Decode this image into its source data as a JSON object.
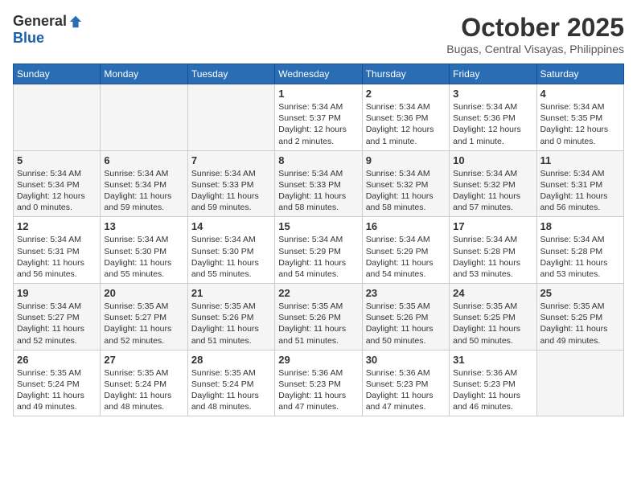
{
  "header": {
    "logo_general": "General",
    "logo_blue": "Blue",
    "month_year": "October 2025",
    "location": "Bugas, Central Visayas, Philippines"
  },
  "weekdays": [
    "Sunday",
    "Monday",
    "Tuesday",
    "Wednesday",
    "Thursday",
    "Friday",
    "Saturday"
  ],
  "weeks": [
    [
      {
        "day": "",
        "empty": true
      },
      {
        "day": "",
        "empty": true
      },
      {
        "day": "",
        "empty": true
      },
      {
        "day": "1",
        "sunrise": "Sunrise: 5:34 AM",
        "sunset": "Sunset: 5:37 PM",
        "daylight": "Daylight: 12 hours and 2 minutes."
      },
      {
        "day": "2",
        "sunrise": "Sunrise: 5:34 AM",
        "sunset": "Sunset: 5:36 PM",
        "daylight": "Daylight: 12 hours and 1 minute."
      },
      {
        "day": "3",
        "sunrise": "Sunrise: 5:34 AM",
        "sunset": "Sunset: 5:36 PM",
        "daylight": "Daylight: 12 hours and 1 minute."
      },
      {
        "day": "4",
        "sunrise": "Sunrise: 5:34 AM",
        "sunset": "Sunset: 5:35 PM",
        "daylight": "Daylight: 12 hours and 0 minutes."
      }
    ],
    [
      {
        "day": "5",
        "sunrise": "Sunrise: 5:34 AM",
        "sunset": "Sunset: 5:34 PM",
        "daylight": "Daylight: 12 hours and 0 minutes."
      },
      {
        "day": "6",
        "sunrise": "Sunrise: 5:34 AM",
        "sunset": "Sunset: 5:34 PM",
        "daylight": "Daylight: 11 hours and 59 minutes."
      },
      {
        "day": "7",
        "sunrise": "Sunrise: 5:34 AM",
        "sunset": "Sunset: 5:33 PM",
        "daylight": "Daylight: 11 hours and 59 minutes."
      },
      {
        "day": "8",
        "sunrise": "Sunrise: 5:34 AM",
        "sunset": "Sunset: 5:33 PM",
        "daylight": "Daylight: 11 hours and 58 minutes."
      },
      {
        "day": "9",
        "sunrise": "Sunrise: 5:34 AM",
        "sunset": "Sunset: 5:32 PM",
        "daylight": "Daylight: 11 hours and 58 minutes."
      },
      {
        "day": "10",
        "sunrise": "Sunrise: 5:34 AM",
        "sunset": "Sunset: 5:32 PM",
        "daylight": "Daylight: 11 hours and 57 minutes."
      },
      {
        "day": "11",
        "sunrise": "Sunrise: 5:34 AM",
        "sunset": "Sunset: 5:31 PM",
        "daylight": "Daylight: 11 hours and 56 minutes."
      }
    ],
    [
      {
        "day": "12",
        "sunrise": "Sunrise: 5:34 AM",
        "sunset": "Sunset: 5:31 PM",
        "daylight": "Daylight: 11 hours and 56 minutes."
      },
      {
        "day": "13",
        "sunrise": "Sunrise: 5:34 AM",
        "sunset": "Sunset: 5:30 PM",
        "daylight": "Daylight: 11 hours and 55 minutes."
      },
      {
        "day": "14",
        "sunrise": "Sunrise: 5:34 AM",
        "sunset": "Sunset: 5:30 PM",
        "daylight": "Daylight: 11 hours and 55 minutes."
      },
      {
        "day": "15",
        "sunrise": "Sunrise: 5:34 AM",
        "sunset": "Sunset: 5:29 PM",
        "daylight": "Daylight: 11 hours and 54 minutes."
      },
      {
        "day": "16",
        "sunrise": "Sunrise: 5:34 AM",
        "sunset": "Sunset: 5:29 PM",
        "daylight": "Daylight: 11 hours and 54 minutes."
      },
      {
        "day": "17",
        "sunrise": "Sunrise: 5:34 AM",
        "sunset": "Sunset: 5:28 PM",
        "daylight": "Daylight: 11 hours and 53 minutes."
      },
      {
        "day": "18",
        "sunrise": "Sunrise: 5:34 AM",
        "sunset": "Sunset: 5:28 PM",
        "daylight": "Daylight: 11 hours and 53 minutes."
      }
    ],
    [
      {
        "day": "19",
        "sunrise": "Sunrise: 5:34 AM",
        "sunset": "Sunset: 5:27 PM",
        "daylight": "Daylight: 11 hours and 52 minutes."
      },
      {
        "day": "20",
        "sunrise": "Sunrise: 5:35 AM",
        "sunset": "Sunset: 5:27 PM",
        "daylight": "Daylight: 11 hours and 52 minutes."
      },
      {
        "day": "21",
        "sunrise": "Sunrise: 5:35 AM",
        "sunset": "Sunset: 5:26 PM",
        "daylight": "Daylight: 11 hours and 51 minutes."
      },
      {
        "day": "22",
        "sunrise": "Sunrise: 5:35 AM",
        "sunset": "Sunset: 5:26 PM",
        "daylight": "Daylight: 11 hours and 51 minutes."
      },
      {
        "day": "23",
        "sunrise": "Sunrise: 5:35 AM",
        "sunset": "Sunset: 5:26 PM",
        "daylight": "Daylight: 11 hours and 50 minutes."
      },
      {
        "day": "24",
        "sunrise": "Sunrise: 5:35 AM",
        "sunset": "Sunset: 5:25 PM",
        "daylight": "Daylight: 11 hours and 50 minutes."
      },
      {
        "day": "25",
        "sunrise": "Sunrise: 5:35 AM",
        "sunset": "Sunset: 5:25 PM",
        "daylight": "Daylight: 11 hours and 49 minutes."
      }
    ],
    [
      {
        "day": "26",
        "sunrise": "Sunrise: 5:35 AM",
        "sunset": "Sunset: 5:24 PM",
        "daylight": "Daylight: 11 hours and 49 minutes."
      },
      {
        "day": "27",
        "sunrise": "Sunrise: 5:35 AM",
        "sunset": "Sunset: 5:24 PM",
        "daylight": "Daylight: 11 hours and 48 minutes."
      },
      {
        "day": "28",
        "sunrise": "Sunrise: 5:35 AM",
        "sunset": "Sunset: 5:24 PM",
        "daylight": "Daylight: 11 hours and 48 minutes."
      },
      {
        "day": "29",
        "sunrise": "Sunrise: 5:36 AM",
        "sunset": "Sunset: 5:23 PM",
        "daylight": "Daylight: 11 hours and 47 minutes."
      },
      {
        "day": "30",
        "sunrise": "Sunrise: 5:36 AM",
        "sunset": "Sunset: 5:23 PM",
        "daylight": "Daylight: 11 hours and 47 minutes."
      },
      {
        "day": "31",
        "sunrise": "Sunrise: 5:36 AM",
        "sunset": "Sunset: 5:23 PM",
        "daylight": "Daylight: 11 hours and 46 minutes."
      },
      {
        "day": "",
        "empty": true
      }
    ]
  ]
}
